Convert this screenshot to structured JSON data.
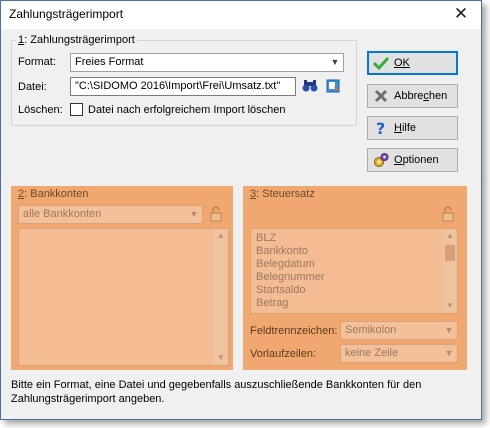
{
  "window": {
    "title": "Zahlungsträgerimport",
    "close_label": "✕"
  },
  "import_group": {
    "legend_num": "1",
    "legend_rest": ": Zahlungsträgerimport",
    "format_label": "Format:",
    "format_value": "Freies Format",
    "file_label": "Datei:",
    "file_value": "\"C:\\SIDOMO 2016\\Import\\Frei\\Umsatz.txt\"",
    "delete_label": "Löschen:",
    "delete_checkbox_label": "Datei nach erfolgreichem Import löschen"
  },
  "buttons": {
    "ok": "OK",
    "cancel_pre": "Abbre",
    "cancel_u": "c",
    "cancel_post": "hen",
    "help_u": "H",
    "help_post": "ilfe",
    "options_u": "O",
    "options_post": "ptionen"
  },
  "bank_group": {
    "legend_num": "2",
    "legend_rest": ": Bankkonten",
    "combo_value": "alle Bankkonten"
  },
  "tax_group": {
    "legend_num": "3",
    "legend_rest": ": Steuersatz",
    "list_items": [
      "BLZ",
      "Bankkonto",
      "Belegdatum",
      "Belegnummer",
      "Startsaldo",
      "Betrag"
    ],
    "separator_label": "Feldtrennzeichen:",
    "separator_value": "Semikolon",
    "header_label": "Vorlaufzeilen:",
    "header_value": "keine Zeile"
  },
  "info": "Bitte ein Format, eine Datei und gegebenfalls auszuschließende Bankkonten für den Zahlungsträgerimport angeben.",
  "colors": {
    "disabled_orange": "#f0a870",
    "accent": "#0078d7"
  }
}
